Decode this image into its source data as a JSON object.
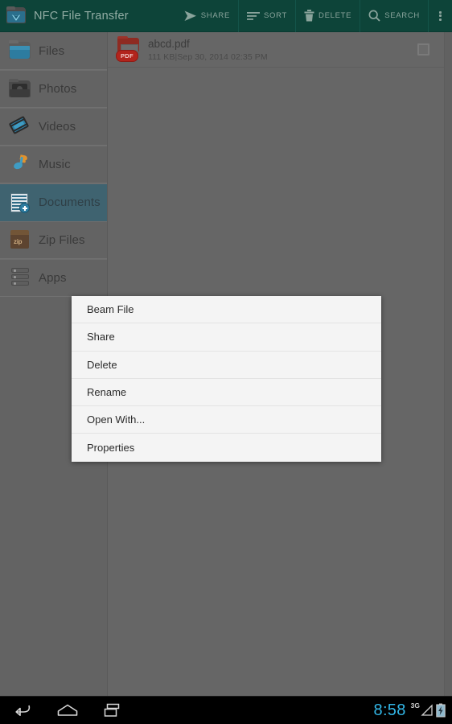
{
  "actionbar": {
    "app_icon": "nfc-folder-icon",
    "title": "NFC File Transfer",
    "bg_color": "#0d4439",
    "actions": [
      {
        "label": "SHARE",
        "icon": "share-icon"
      },
      {
        "label": "SORT",
        "icon": "sort-icon"
      },
      {
        "label": "DELETE",
        "icon": "trash-icon"
      },
      {
        "label": "SEARCH",
        "icon": "search-icon"
      }
    ],
    "overflow": "overflow-menu-icon"
  },
  "sidebar": {
    "items": [
      {
        "label": "Files",
        "icon": "folder-blue-icon",
        "selected": false
      },
      {
        "label": "Photos",
        "icon": "folder-camera-icon",
        "selected": false
      },
      {
        "label": "Videos",
        "icon": "film-strip-icon",
        "selected": false
      },
      {
        "label": "Music",
        "icon": "music-note-icon",
        "selected": false
      },
      {
        "label": "Documents",
        "icon": "document-icon",
        "selected": true
      },
      {
        "label": "Zip Files",
        "icon": "zip-box-icon",
        "selected": false
      },
      {
        "label": "Apps",
        "icon": "apps-stack-icon",
        "selected": false
      }
    ],
    "selected_color": "#3f6370"
  },
  "content": {
    "files": [
      {
        "name": "abcd.pdf",
        "size": "111 KB",
        "separator": "|",
        "date": "Sep 30, 2014 02:35 PM",
        "badge": "PDF",
        "icon": "pdf-file-icon",
        "checked": false
      }
    ]
  },
  "context_menu": {
    "items": [
      {
        "label": "Beam File"
      },
      {
        "label": "Share"
      },
      {
        "label": "Delete"
      },
      {
        "label": "Rename"
      },
      {
        "label": "Open With..."
      },
      {
        "label": "Properties"
      }
    ]
  },
  "navbar": {
    "back": "back-icon",
    "home": "home-icon",
    "recents": "recents-icon",
    "clock": "8:58",
    "network": "3G",
    "signal": "signal-icon",
    "battery": "battery-charging-icon",
    "clock_color": "#32b6e6"
  }
}
